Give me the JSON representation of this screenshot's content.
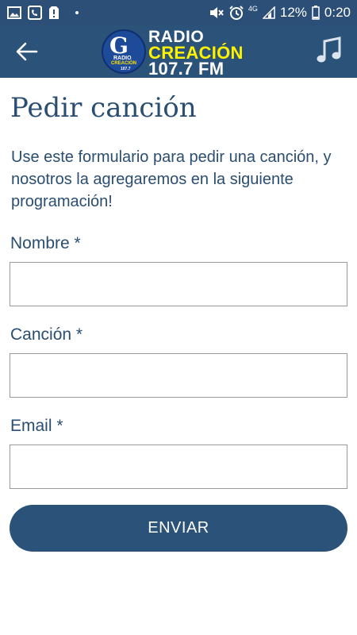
{
  "status_bar": {
    "battery_percent": "12%",
    "time": "0:20",
    "network": "4G"
  },
  "app_bar": {
    "logo": {
      "line1": "RADIO",
      "line2": "CREACIÓN",
      "line3": "107.7 FM",
      "mini1": "RADIO",
      "mini2": "CREACIÓN",
      "mini3": "107.7"
    }
  },
  "page": {
    "title": "Pedir canción",
    "intro": "Use este formulario para pedir una canción, y nosotros la agregaremos en la siguiente programación!"
  },
  "form": {
    "name_label": "Nombre *",
    "name_value": "",
    "song_label": "Canción *",
    "song_value": "",
    "email_label": "Email *",
    "email_value": "",
    "submit_label": "ENVIAR"
  },
  "icons": {
    "back": "arrow-left-icon",
    "music": "music-note-icon"
  },
  "colors": {
    "primary": "#2b5278",
    "status_bar": "#2b4f76",
    "text": "#2a4d72",
    "logo_yellow": "#fff200"
  }
}
